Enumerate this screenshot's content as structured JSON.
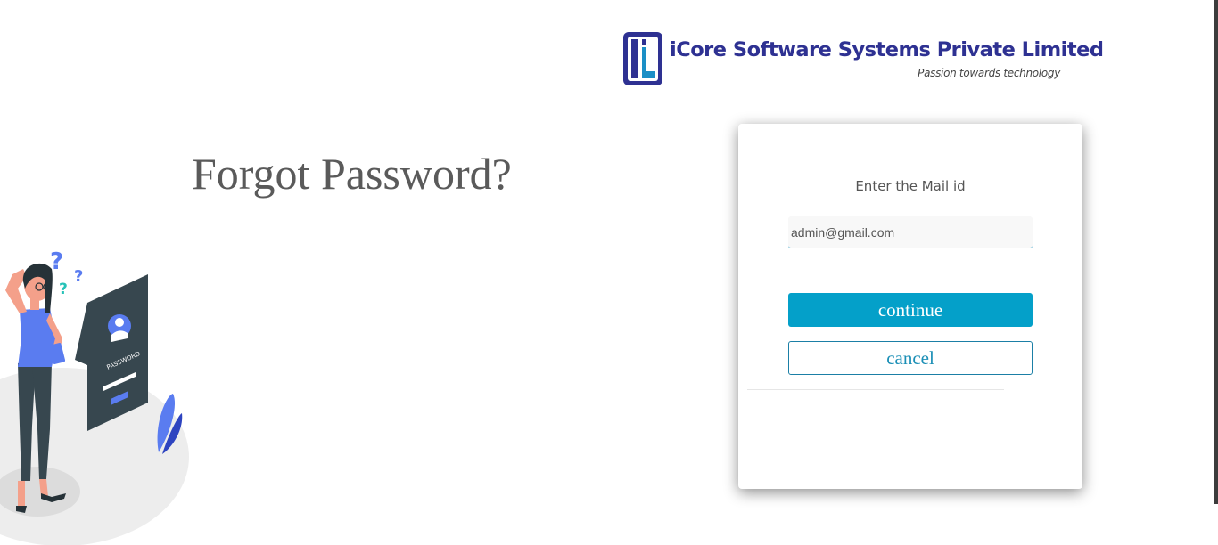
{
  "brand": {
    "name": "iCore Software Systems Private Limited",
    "tagline": "Passion towards technology",
    "primary_color": "#2e3192",
    "accent_color": "#04a0c9"
  },
  "page": {
    "heading": "Forgot Password?"
  },
  "illustration": {
    "icon": "confused-woman-password-icon",
    "label": "PASSWORD"
  },
  "form": {
    "label": "Enter the Mail id",
    "email_value": "admin@gmail.com",
    "continue_label": "continue",
    "cancel_label": "cancel"
  }
}
